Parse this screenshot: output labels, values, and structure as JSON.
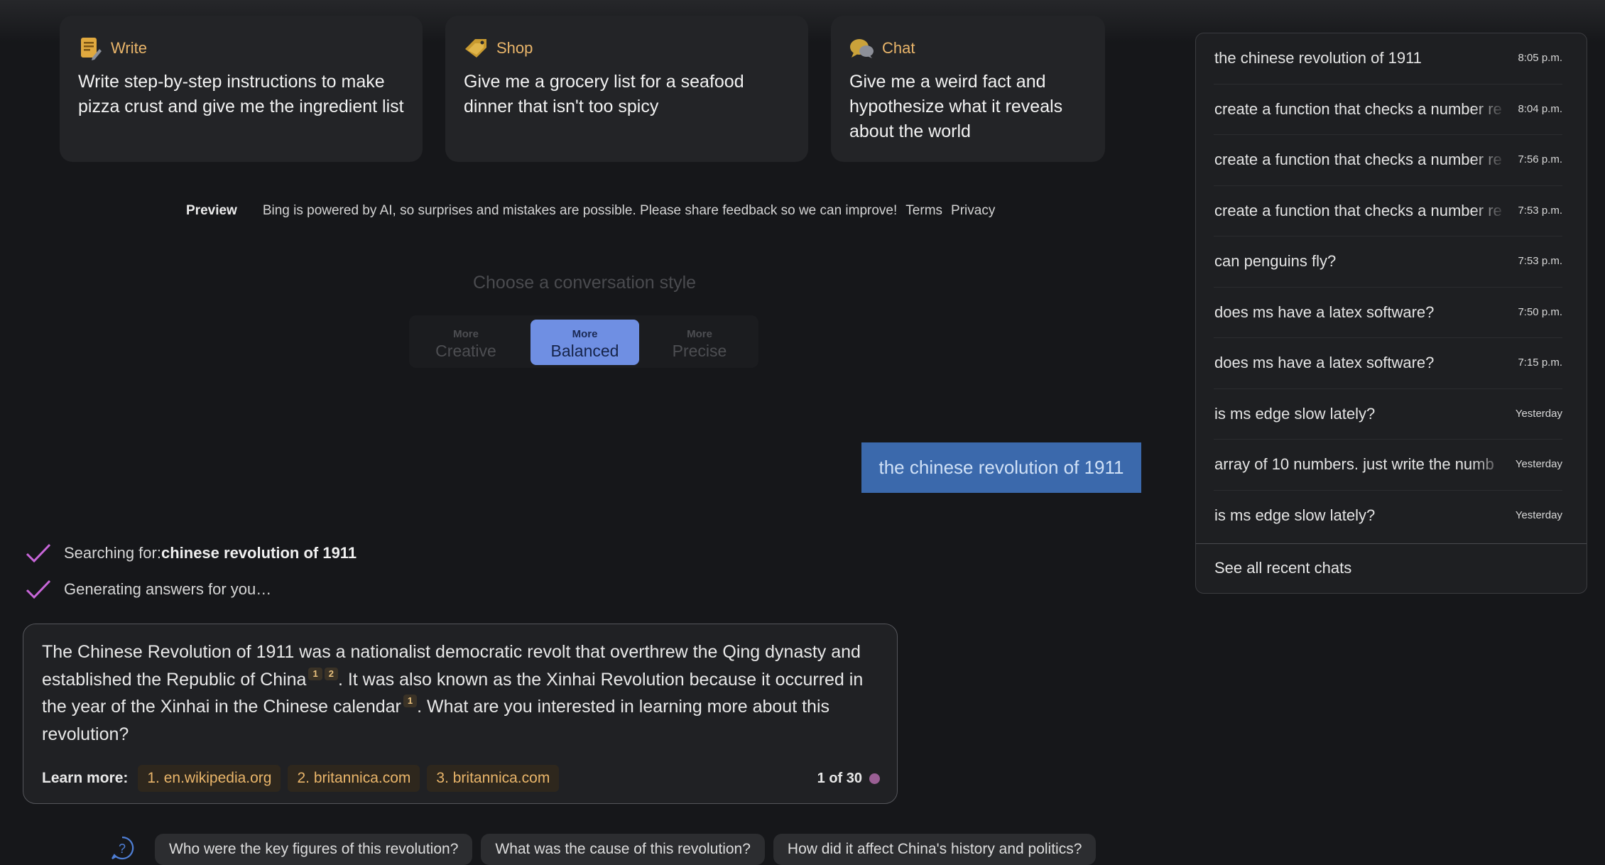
{
  "cards": [
    {
      "title": "Write",
      "icon": "write-notepad-icon",
      "text": "Write step-by-step instructions to make pizza crust and give me the ingredient list"
    },
    {
      "title": "Shop",
      "icon": "shop-tag-icon",
      "text": "Give me a grocery list for a seafood dinner that isn't too spicy"
    },
    {
      "title": "Chat",
      "icon": "chat-bubbles-icon",
      "text": "Give me a weird fact and hypothesize what it reveals about the world"
    }
  ],
  "disclaimer": {
    "preview": "Preview",
    "text": "Bing is powered by AI, so surprises and mistakes are possible. Please share feedback so we can improve!",
    "terms": "Terms",
    "privacy": "Privacy"
  },
  "style_selector": {
    "label": "Choose a conversation style",
    "options": [
      {
        "top": "More",
        "bottom": "Creative",
        "selected": false
      },
      {
        "top": "More",
        "bottom": "Balanced",
        "selected": true
      },
      {
        "top": "More",
        "bottom": "Precise",
        "selected": false
      }
    ]
  },
  "user_message": "the chinese revolution of 1911",
  "steps": [
    {
      "prefix": "Searching for: ",
      "bold": "chinese revolution of 1911"
    },
    {
      "prefix": "Generating answers for you…",
      "bold": ""
    }
  ],
  "answer": {
    "part1": "The Chinese Revolution of 1911 was a nationalist democratic revolt that overthrew the Qing dynasty and established the Republic of China",
    "cite1": "1",
    "cite2": "2",
    "part2": ". It was also known as the Xinhai Revolution because it occurred in the year of the Xinhai in the Chinese calendar",
    "cite3": "1",
    "part3": ". What are you interested in learning more about this revolution?",
    "learn_more_label": "Learn more:",
    "links": [
      "1. en.wikipedia.org",
      "2. britannica.com",
      "3. britannica.com"
    ],
    "counter": "1 of 30",
    "accent_color": "#e9b56a"
  },
  "followups": [
    "Who were the key figures of this revolution?",
    "What was the cause of this revolution?",
    "How did it affect China's history and politics?"
  ],
  "recent_chats": {
    "items": [
      {
        "title": "the chinese revolution of 1911",
        "time": "8:05 p.m."
      },
      {
        "title": "create a function that checks a number re",
        "time": "8:04 p.m."
      },
      {
        "title": "create a function that checks a number re",
        "time": "7:56 p.m."
      },
      {
        "title": "create a function that checks a number re",
        "time": "7:53 p.m."
      },
      {
        "title": "can penguins fly?",
        "time": "7:53 p.m."
      },
      {
        "title": "does ms have a latex software?",
        "time": "7:50 p.m."
      },
      {
        "title": "does ms have a latex software?",
        "time": "7:15 p.m."
      },
      {
        "title": "is ms edge slow lately?",
        "time": "Yesterday"
      },
      {
        "title": "array of 10 numbers. just write the numb",
        "time": "Yesterday"
      },
      {
        "title": "is ms edge slow lately?",
        "time": "Yesterday"
      }
    ],
    "see_all": "See all recent chats"
  }
}
